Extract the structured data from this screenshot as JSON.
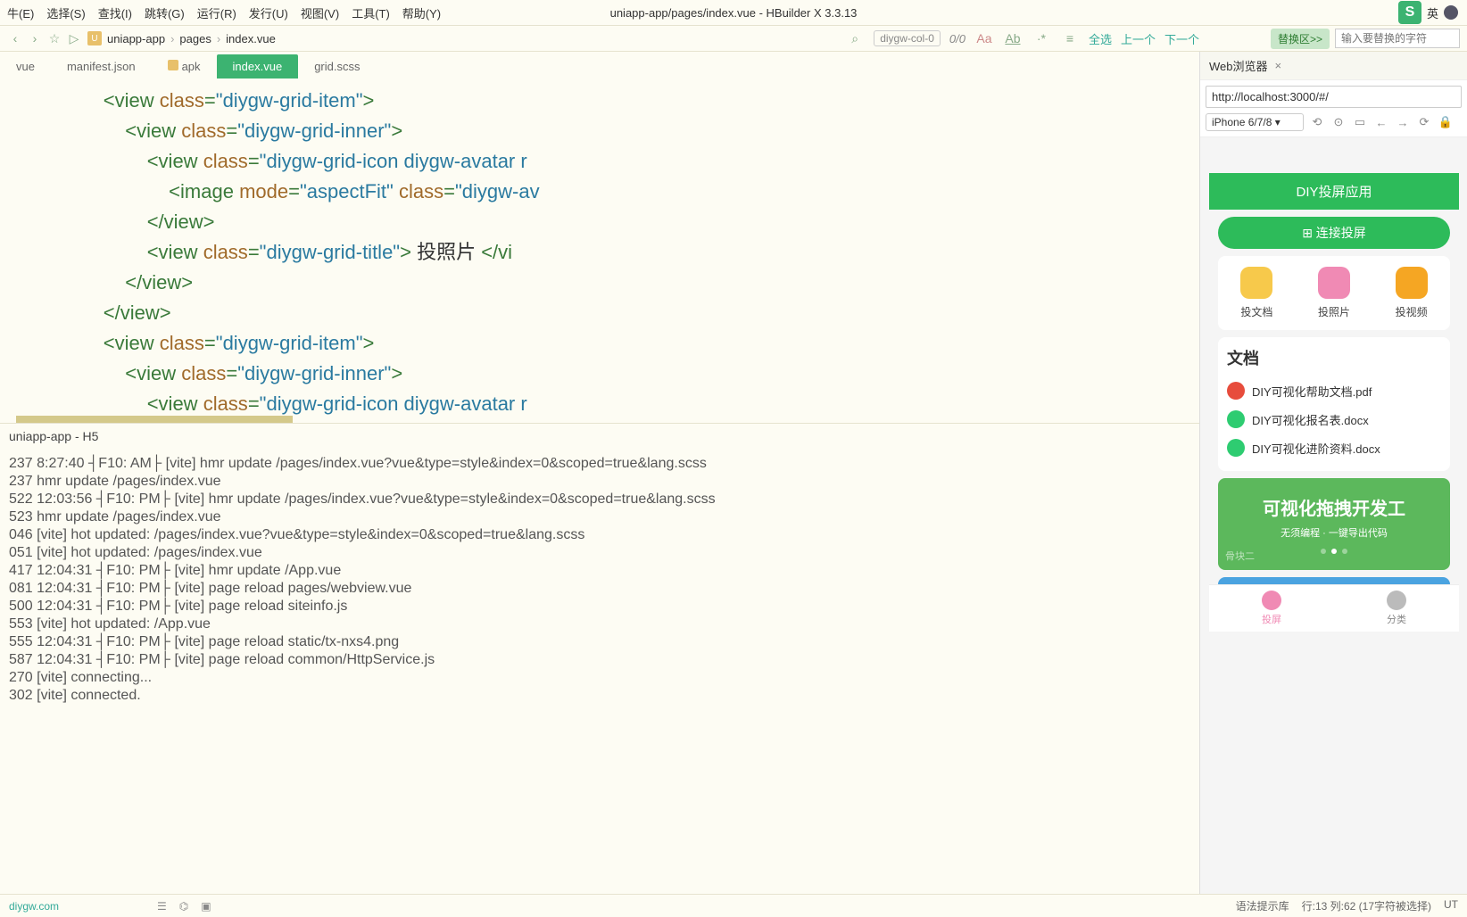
{
  "menubar": {
    "items": [
      "牛(E)",
      "选择(S)",
      "查找(I)",
      "跳转(G)",
      "运行(R)",
      "发行(U)",
      "视图(V)",
      "工具(T)",
      "帮助(Y)"
    ],
    "title": "uniapp-app/pages/index.vue - HBuilder X 3.3.13",
    "ime": "S",
    "ime_lang": "英"
  },
  "toolbar": {
    "breadcrumb": [
      "uniapp-app",
      "pages",
      "index.vue"
    ],
    "search_pill": "diygw-col-0",
    "counter": "0/0",
    "nav_all": "全选",
    "nav_prev": "上一个",
    "nav_next": "下一个",
    "replace_btn": "替换区>>",
    "replace_placeholder": "输入要替换的字符"
  },
  "tabs": [
    "vue",
    "manifest.json",
    "apk",
    "index.vue",
    "grid.scss"
  ],
  "tabs_active_idx": 3,
  "code_lines": [
    {
      "indent": 4,
      "parts": [
        [
          "tag",
          "<view"
        ],
        [
          "sp",
          " "
        ],
        [
          "attr",
          "class"
        ],
        [
          "tag",
          "="
        ],
        [
          "val",
          "\"diygw-grid-item\""
        ],
        [
          "tag",
          ">"
        ]
      ]
    },
    {
      "indent": 5,
      "parts": [
        [
          "tag",
          "<view"
        ],
        [
          "sp",
          " "
        ],
        [
          "attr",
          "class"
        ],
        [
          "tag",
          "="
        ],
        [
          "val",
          "\"diygw-grid-inner\""
        ],
        [
          "tag",
          ">"
        ]
      ]
    },
    {
      "indent": 6,
      "parts": [
        [
          "tag",
          "<view"
        ],
        [
          "sp",
          " "
        ],
        [
          "attr",
          "class"
        ],
        [
          "tag",
          "="
        ],
        [
          "val",
          "\"diygw-grid-icon diygw-avatar r"
        ]
      ]
    },
    {
      "indent": 7,
      "parts": [
        [
          "tag",
          "<image"
        ],
        [
          "sp",
          " "
        ],
        [
          "attr",
          "mode"
        ],
        [
          "tag",
          "="
        ],
        [
          "val",
          "\"aspectFit\""
        ],
        [
          "sp",
          " "
        ],
        [
          "attr",
          "class"
        ],
        [
          "tag",
          "="
        ],
        [
          "val",
          "\"diygw-av"
        ]
      ]
    },
    {
      "indent": 6,
      "parts": [
        [
          "tag",
          "</view>"
        ]
      ]
    },
    {
      "indent": 6,
      "parts": [
        [
          "tag",
          "<view"
        ],
        [
          "sp",
          " "
        ],
        [
          "attr",
          "class"
        ],
        [
          "tag",
          "="
        ],
        [
          "val",
          "\"diygw-grid-title\""
        ],
        [
          "tag",
          ">"
        ],
        [
          "txt",
          " 投照片 "
        ],
        [
          "tag",
          "</vi"
        ]
      ]
    },
    {
      "indent": 5,
      "parts": [
        [
          "tag",
          "</view>"
        ]
      ]
    },
    {
      "indent": 4,
      "parts": [
        [
          "tag",
          "</view>"
        ]
      ]
    },
    {
      "indent": 4,
      "parts": [
        [
          "tag",
          "<view"
        ],
        [
          "sp",
          " "
        ],
        [
          "attr",
          "class"
        ],
        [
          "tag",
          "="
        ],
        [
          "val",
          "\"diygw-grid-item\""
        ],
        [
          "tag",
          ">"
        ]
      ]
    },
    {
      "indent": 5,
      "parts": [
        [
          "tag",
          "<view"
        ],
        [
          "sp",
          " "
        ],
        [
          "attr",
          "class"
        ],
        [
          "tag",
          "="
        ],
        [
          "val",
          "\"diygw-grid-inner\""
        ],
        [
          "tag",
          ">"
        ]
      ]
    },
    {
      "indent": 6,
      "parts": [
        [
          "tag",
          "<view"
        ],
        [
          "sp",
          " "
        ],
        [
          "attr",
          "class"
        ],
        [
          "tag",
          "="
        ],
        [
          "val",
          "\"diygw-grid-icon diygw-avatar r"
        ]
      ]
    }
  ],
  "terminal": {
    "title": "uniapp-app - H5",
    "lines": [
      "237 8:27:40 ┤F10: AM├ [vite] hmr update /pages/index.vue?vue&type=style&index=0&scoped=true&lang.scss",
      "237 hmr update /pages/index.vue",
      "522 12:03:56 ┤F10: PM├ [vite] hmr update /pages/index.vue?vue&type=style&index=0&scoped=true&lang.scss",
      "523 hmr update /pages/index.vue",
      "046 [vite] hot updated: /pages/index.vue?vue&type=style&index=0&scoped=true&lang.scss",
      "051 [vite] hot updated: /pages/index.vue",
      "417 12:04:31 ┤F10: PM├ [vite] hmr update /App.vue",
      "081 12:04:31 ┤F10: PM├ [vite] page reload pages/webview.vue",
      "500 12:04:31 ┤F10: PM├ [vite] page reload siteinfo.js",
      "553 [vite] hot updated: /App.vue",
      "555 12:04:31 ┤F10: PM├ [vite] page reload static/tx-nxs4.png",
      "587 12:04:31 ┤F10: PM├ [vite] page reload common/HttpService.js",
      "270 [vite] connecting...",
      "302 [vite] connected."
    ]
  },
  "statusbar": {
    "left": "diygw.com",
    "right": [
      "语法提示库",
      "行:13 列:62 (17字符被选择)",
      "UT"
    ]
  },
  "web": {
    "tab": "Web浏览器",
    "url": "http://localhost:3000/#/",
    "device": "iPhone 6/7/8",
    "app_title": "DIY投屏应用",
    "connect": "⊞ 连接投屏",
    "grid": [
      {
        "label": "投文档",
        "color": "#f7c94b"
      },
      {
        "label": "投照片",
        "color": "#f08ab4"
      },
      {
        "label": "投视频",
        "color": "#f5a623"
      }
    ],
    "docs_title": "文档",
    "docs": [
      {
        "name": "DIY可视化帮助文档.pdf",
        "color": "#e74c3c"
      },
      {
        "name": "DIY可视化报名表.docx",
        "color": "#2ecc71"
      },
      {
        "name": "DIY可视化进阶资料.docx",
        "color": "#2ecc71"
      }
    ],
    "banner_big": "可视化拖拽开发工",
    "banner_sub": "无须编程 · 一键导出代码",
    "slab": "骨块二",
    "bottombar": [
      {
        "label": "投屏",
        "color": "#f08ab4",
        "active": true
      },
      {
        "label": "分类",
        "color": "#bbb",
        "active": false
      }
    ]
  }
}
